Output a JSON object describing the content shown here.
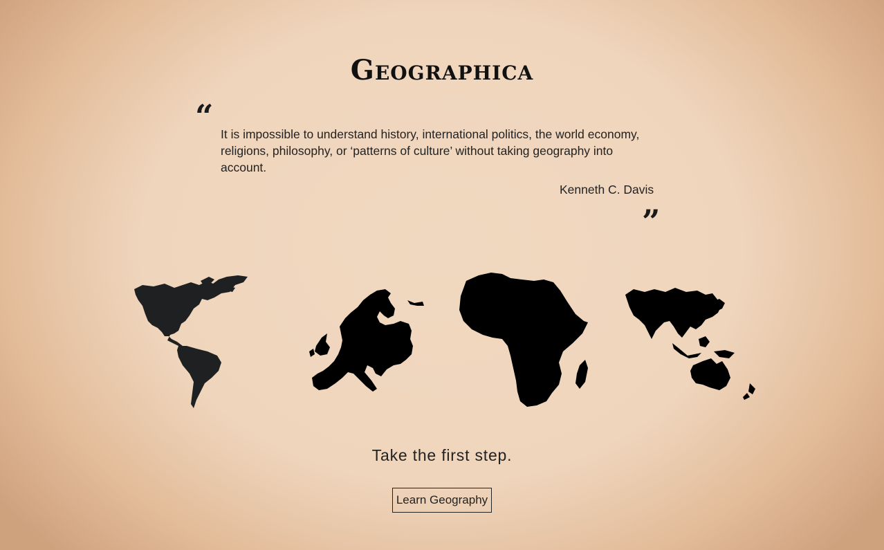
{
  "header": {
    "title": "Geographica"
  },
  "quote": {
    "open_mark": "“",
    "text": "It is impossible to understand history, international politics, the world economy, religions, philosophy, or ‘patterns of culture’ without taking geography into account.",
    "author": "Kenneth C. Davis",
    "close_mark": "”"
  },
  "continents": [
    {
      "name": "americas-map",
      "icon": "americas-map-icon",
      "color": "#1e2022"
    },
    {
      "name": "europe-map",
      "icon": "europe-map-icon",
      "color": "#000000"
    },
    {
      "name": "africa-map",
      "icon": "africa-map-icon",
      "color": "#000000"
    },
    {
      "name": "asia-oceania-map",
      "icon": "asia-oceania-map-icon",
      "color": "#000000"
    }
  ],
  "cta": {
    "tagline": "Take the first step.",
    "button_label": "Learn Geography"
  },
  "colors": {
    "background_center": "#f0d8c0",
    "background_edge": "#cfa27e",
    "text": "#1b1b1b"
  }
}
